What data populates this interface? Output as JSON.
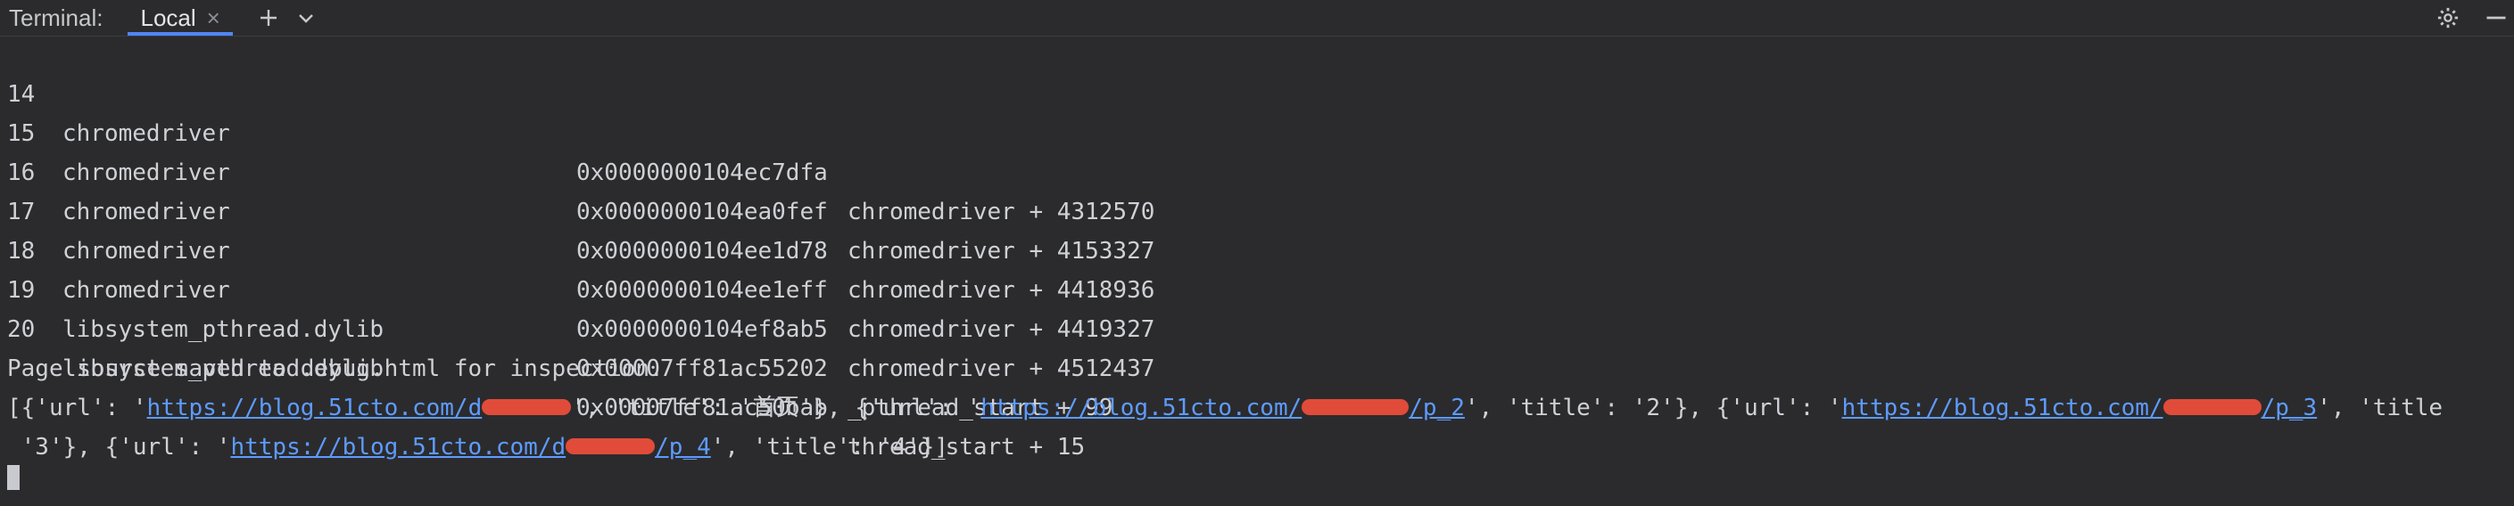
{
  "tabbar": {
    "label": "Terminal:",
    "tab_local": "Local",
    "close_glyph": "×"
  },
  "rows": [
    {
      "num": "14",
      "lib": "chromedriver",
      "addr": "0x0000000104ec7dfa",
      "sym": "chromedriver + 4312570"
    },
    {
      "num": "15",
      "lib": "chromedriver",
      "addr": "0x0000000104ea0fef",
      "sym": "chromedriver + 4153327"
    },
    {
      "num": "16",
      "lib": "chromedriver",
      "addr": "0x0000000104ee1d78",
      "sym": "chromedriver + 4418936"
    },
    {
      "num": "17",
      "lib": "chromedriver",
      "addr": "0x0000000104ee1eff",
      "sym": "chromedriver + 4419327"
    },
    {
      "num": "18",
      "lib": "chromedriver",
      "addr": "0x0000000104ef8ab5",
      "sym": "chromedriver + 4512437"
    },
    {
      "num": "19",
      "lib": "libsystem_pthread.dylib",
      "addr": "0x00007ff81ac55202",
      "sym": "_pthread_start + 99"
    },
    {
      "num": "20",
      "lib": "libsystem_pthread.dylib",
      "addr": "0x00007ff81ac50bab",
      "sym": "thread_start + 15"
    }
  ],
  "message": "Page source saved to debug.html for inspection.",
  "output": {
    "l1_a": "[{'url': '",
    "link1_a": "https://blog.51cto.com/d",
    "link1_b": "",
    "l1_b": "', 'title': '首页'}, {'url': '",
    "link2_a": "https://blog.51cto.com/",
    "link2_b": "/p_2",
    "l1_c": "', 'title': '2'}, {'url': '",
    "link3_a": "https://blog.51cto.com/",
    "link3_b": "/p_3",
    "l1_d": "', 'title",
    "l2_a": " '3'}, {'url': '",
    "link4_a": "https://blog.51cto.com/d",
    "link4_b": "/p_4",
    "l2_b": "', 'title': '4'}]"
  },
  "colors": {
    "background": "#2b2b2d",
    "text": "#cfd1d6",
    "link": "#5e9bff",
    "accent": "#4f86f7",
    "redaction": "#e14b3a"
  },
  "icons": [
    "plus-icon",
    "chevron-down-icon",
    "gear-icon",
    "minimize-icon",
    "close-icon"
  ]
}
